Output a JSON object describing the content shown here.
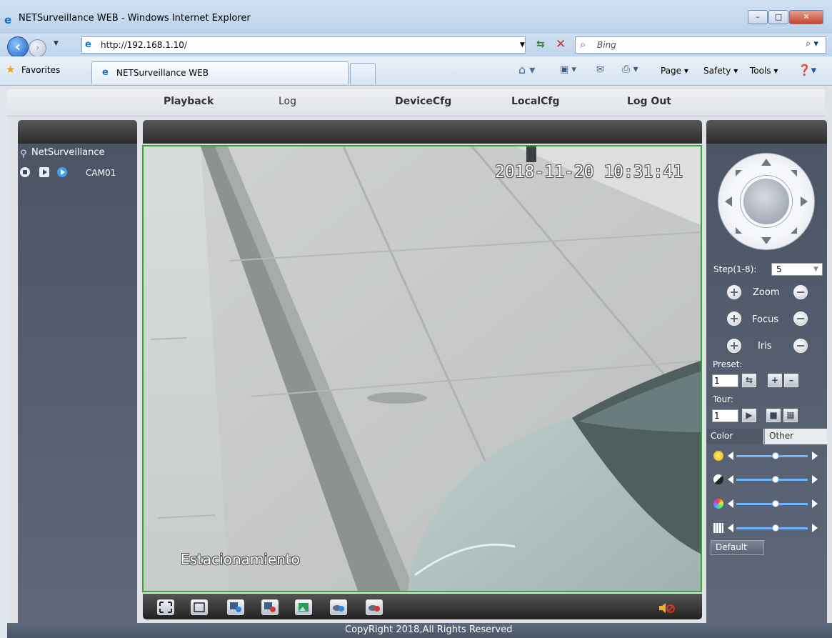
{
  "browser": {
    "window_title": "NETSurveillance WEB - Windows Internet Explorer",
    "url_prefix": "http://",
    "url_host": "192.168.1.10",
    "url_suffix": "/",
    "search_placeholder": "Bing",
    "favorites_label": "Favorites",
    "tab_label": "NETSurveillance WEB",
    "commands": {
      "page": "Page ▾",
      "safety": "Safety ▾",
      "tools": "Tools ▾"
    },
    "window_buttons": {
      "minimize": "–",
      "maximize": "□",
      "close": "✕"
    }
  },
  "app": {
    "menu": {
      "playback": "Playback",
      "log": "Log",
      "devicecfg": "DeviceCfg",
      "localcfg": "LocalCfg",
      "logout": "Log Out"
    },
    "tree": {
      "root": "NetSurveillance",
      "camera": "CAM01"
    },
    "video": {
      "timestamp": "2018-11-20 10:31:41",
      "channel_name": "Estacionamiento"
    },
    "ptz": {
      "step_label": "Step(1-8):",
      "step_value": "5",
      "zoom_label": "Zoom",
      "focus_label": "Focus",
      "iris_label": "Iris",
      "preset_label": "Preset:",
      "preset_value": "1",
      "tour_label": "Tour:",
      "tour_value": "1"
    },
    "image_settings": {
      "tab_color": "Color",
      "tab_other": "Other",
      "sliders": [
        {
          "name": "brightness",
          "icon": "sun-icon",
          "value_fraction": 0.55
        },
        {
          "name": "contrast",
          "icon": "contrast-icon",
          "value_fraction": 0.55
        },
        {
          "name": "saturation",
          "icon": "color-wheel-icon",
          "value_fraction": 0.55
        },
        {
          "name": "hue",
          "icon": "grid-icon",
          "value_fraction": 0.55
        }
      ],
      "default_label": "Default"
    },
    "footer": "CopyRight 2018,All Rights Reserved",
    "colors": {
      "panel_header": "#2c2c2c",
      "panel_body": "#545e6f",
      "video_border": "#35a632",
      "slider_track": "#6eb3ff"
    }
  }
}
